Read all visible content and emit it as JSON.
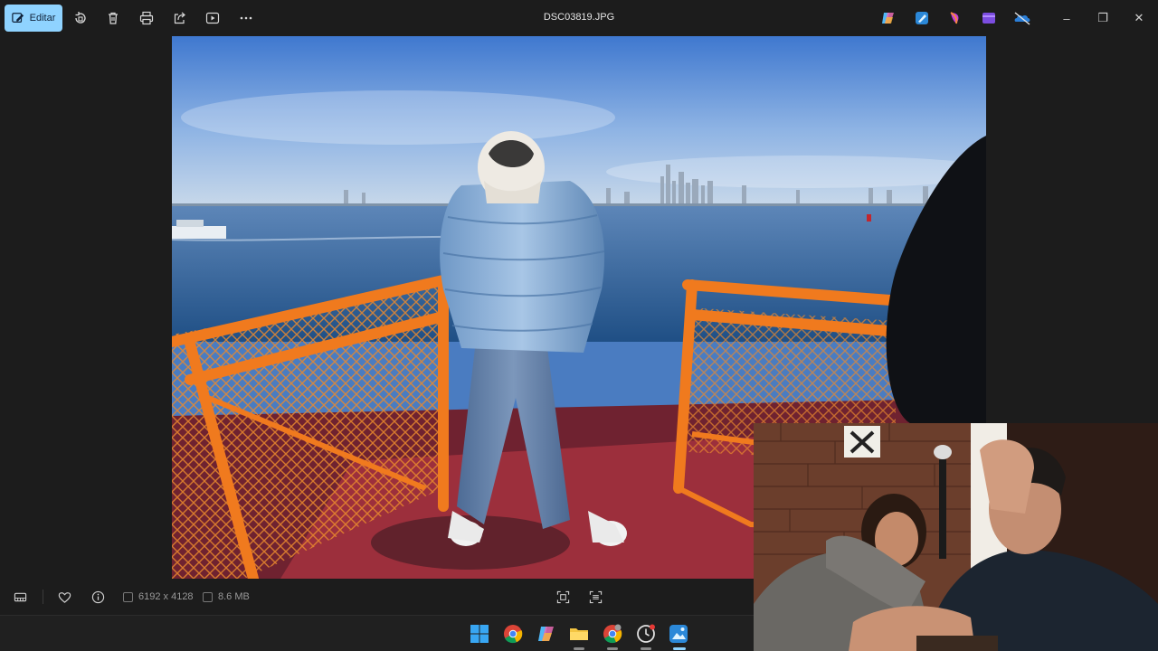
{
  "toolbar": {
    "edit_label": "Editar",
    "title": "DSC03819.JPG",
    "icons": [
      "edit-icon",
      "rotate-icon",
      "delete-icon",
      "print-icon",
      "share-icon",
      "slideshow-icon",
      "more-icon"
    ],
    "app_icons": [
      "copilot-icon",
      "photos-editor-icon",
      "designer-icon",
      "clipchamp-icon",
      "onedrive-icon"
    ]
  },
  "window": {
    "minimize": "–",
    "restore": "❐",
    "close": "✕"
  },
  "statusbar": {
    "dimensions": "6192 x 4128",
    "filesize": "8.6 MB",
    "icons": [
      "filmstrip-icon",
      "favorite-icon",
      "info-icon",
      "fit-screen-icon",
      "actual-size-icon"
    ]
  },
  "taskbar": {
    "icons": [
      "windows-start-icon",
      "chrome-icon",
      "copilot-icon",
      "file-explorer-icon",
      "chrome-profile-icon",
      "clock-app-icon",
      "photos-app-icon"
    ]
  },
  "colors": {
    "accent": "#8fd3ff",
    "railing": "#f07a1e",
    "deck": "#8e2a38",
    "sky": "#5a8fd6"
  }
}
